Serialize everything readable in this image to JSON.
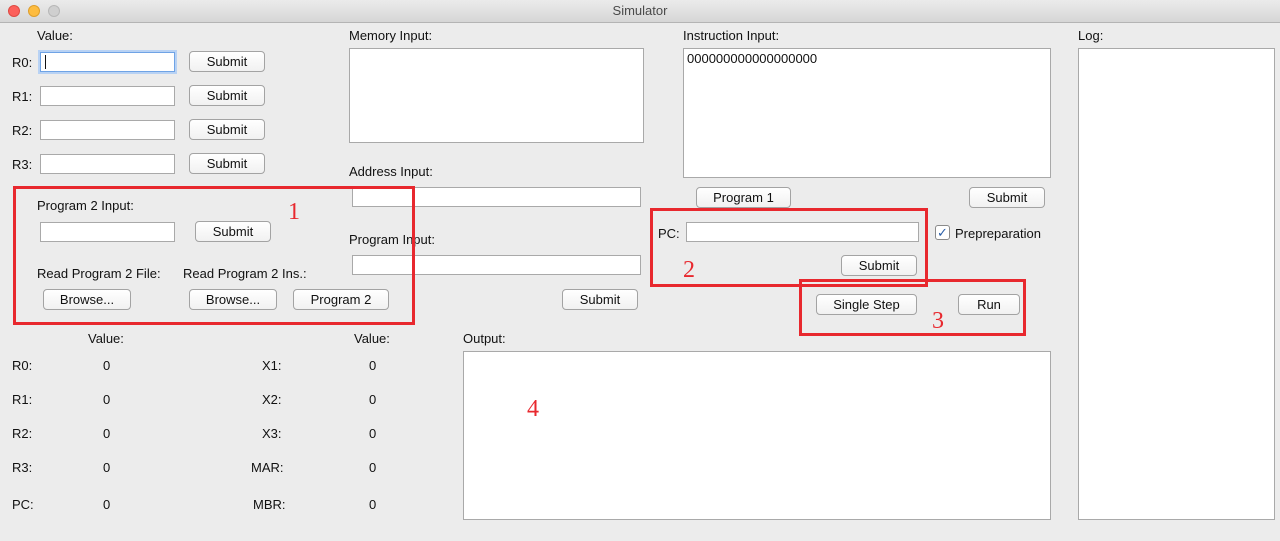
{
  "window": {
    "title": "Simulator"
  },
  "registers_input": {
    "value_header": "Value:",
    "rows": [
      {
        "label": "R0:",
        "value": "",
        "button": "Submit"
      },
      {
        "label": "R1:",
        "value": "",
        "button": "Submit"
      },
      {
        "label": "R2:",
        "value": "",
        "button": "Submit"
      },
      {
        "label": "R3:",
        "value": "",
        "button": "Submit"
      }
    ]
  },
  "program2": {
    "input_label": "Program 2 Input:",
    "input_value": "",
    "submit_label": "Submit",
    "read_file_label": "Read Program 2 File:",
    "read_ins_label": "Read Program 2 Ins.:",
    "browse_file_label": "Browse...",
    "browse_ins_label": "Browse...",
    "program2_button": "Program 2"
  },
  "memory": {
    "label": "Memory Input:",
    "value": ""
  },
  "address": {
    "label": "Address Input:",
    "value": ""
  },
  "program_input": {
    "label": "Program Input:",
    "value": "",
    "submit_label": "Submit"
  },
  "instruction": {
    "label": "Instruction Input:",
    "value": "000000000000000000",
    "program1_button": "Program 1",
    "submit_label": "Submit"
  },
  "pc_input": {
    "label": "PC:",
    "value": "",
    "submit_label": "Submit",
    "prep_label": "Prepreparation",
    "prep_checked": true
  },
  "controls": {
    "single_step": "Single Step",
    "run": "Run"
  },
  "log": {
    "label": "Log:",
    "value": ""
  },
  "output": {
    "label": "Output:",
    "value": ""
  },
  "registers_display": {
    "left_header": "Value:",
    "right_header": "Value:",
    "left": [
      {
        "label": "R0:",
        "value": "0"
      },
      {
        "label": "R1:",
        "value": "0"
      },
      {
        "label": "R2:",
        "value": "0"
      },
      {
        "label": "R3:",
        "value": "0"
      },
      {
        "label": "PC:",
        "value": "0"
      }
    ],
    "right": [
      {
        "label": "X1:",
        "value": "0"
      },
      {
        "label": "X2:",
        "value": "0"
      },
      {
        "label": "X3:",
        "value": "0"
      },
      {
        "label": "MAR:",
        "value": "0"
      },
      {
        "label": "MBR:",
        "value": "0"
      }
    ]
  },
  "annotations": [
    "1",
    "2",
    "3",
    "4"
  ],
  "colors": {
    "annotation": "#e8282e",
    "focus": "#6fa3e5"
  }
}
